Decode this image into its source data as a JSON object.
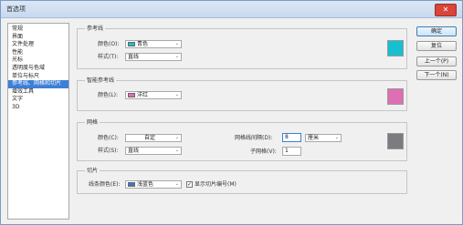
{
  "window": {
    "title": "首选项",
    "close_glyph": "✕"
  },
  "sidebar": {
    "items": [
      {
        "label": "常规",
        "selected": false
      },
      {
        "label": "界面",
        "selected": false
      },
      {
        "label": "文件处理",
        "selected": false
      },
      {
        "label": "性能",
        "selected": false
      },
      {
        "label": "光标",
        "selected": false
      },
      {
        "label": "透明度与色域",
        "selected": false
      },
      {
        "label": "单位与标尺",
        "selected": false
      },
      {
        "label": "参考线、网格和切片",
        "selected": true
      },
      {
        "label": "增效工具",
        "selected": false
      },
      {
        "label": "文字",
        "selected": false
      },
      {
        "label": "3D",
        "selected": false
      }
    ]
  },
  "guides": {
    "legend": "参考线",
    "color_label": "颜色(O):",
    "color_value": "青色",
    "color_hex": "#17bfd0",
    "style_label": "样式(T):",
    "style_value": "直线"
  },
  "smart_guides": {
    "legend": "智能参考线",
    "color_label": "颜色(L):",
    "color_value": "洋红",
    "color_hex": "#de6fb5"
  },
  "grid": {
    "legend": "网格",
    "color_label": "颜色(C):",
    "color_value": "自定",
    "color_hex": "#7b7b80",
    "style_label": "样式(S):",
    "style_value": "直线",
    "gridline_label": "网格线间隔(D):",
    "gridline_value": "8",
    "gridline_unit": "厘米",
    "subdiv_label": "子网格(V):",
    "subdiv_value": "1"
  },
  "slices": {
    "legend": "切片",
    "color_label": "线条颜色(E):",
    "color_value": "浅蓝色",
    "color_hex": "#3a78c8",
    "show_numbers_label": "显示切片编号(M)",
    "show_numbers_checked": true,
    "check_glyph": "✓"
  },
  "buttons": {
    "ok": "确定",
    "reset": "复位",
    "prev": "上一个(P)",
    "next": "下一个(N)"
  },
  "glyphs": {
    "dropdown": "⌄"
  }
}
